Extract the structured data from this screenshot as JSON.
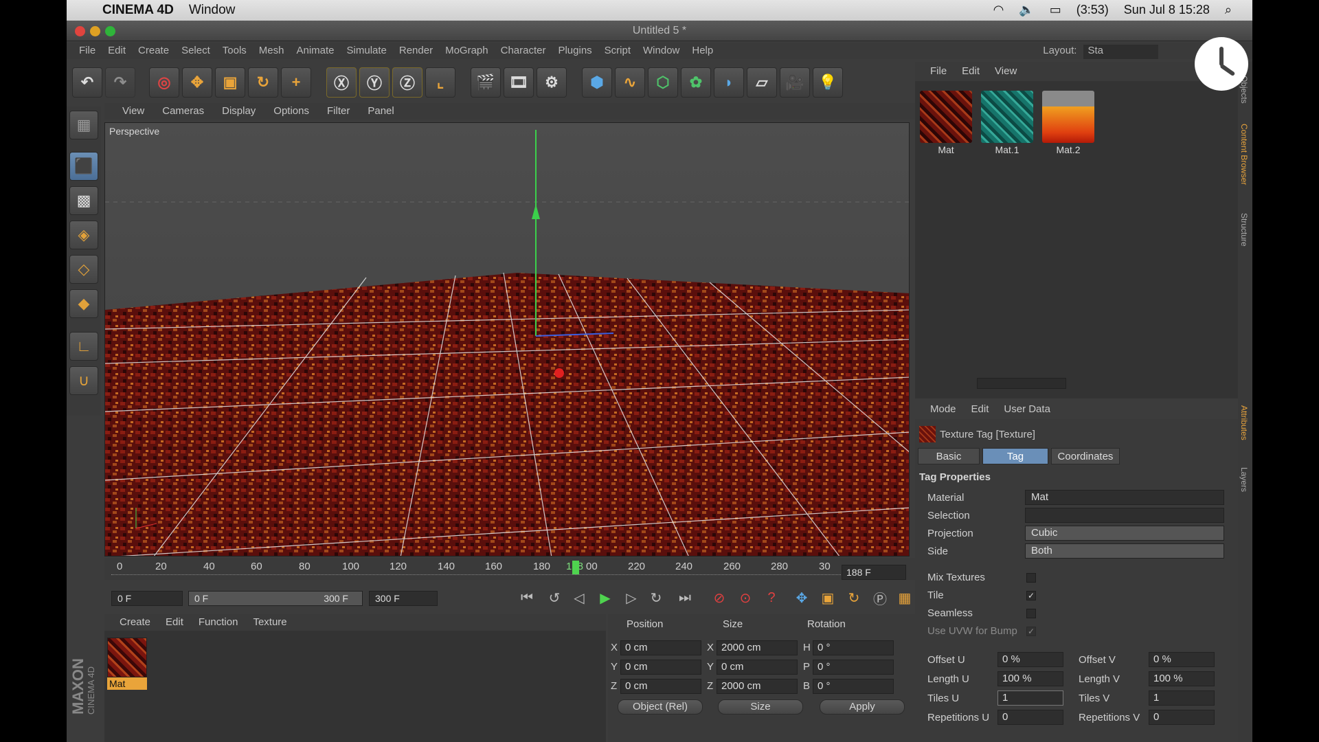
{
  "macbar": {
    "app": "CINEMA 4D",
    "window": "Window",
    "battery": "(3:53)",
    "datetime": "Sun Jul 8  15:28"
  },
  "titlebar": {
    "title": "Untitled 5 *"
  },
  "app_menu": [
    "File",
    "Edit",
    "Create",
    "Select",
    "Tools",
    "Mesh",
    "Animate",
    "Simulate",
    "Render",
    "MoGraph",
    "Character",
    "Plugins",
    "Script",
    "Window",
    "Help"
  ],
  "layout": {
    "label": "Layout:",
    "value": "Sta"
  },
  "viewport_menu": [
    "View",
    "Cameras",
    "Display",
    "Options",
    "Filter",
    "Panel"
  ],
  "viewport": {
    "label": "Perspective"
  },
  "timeline": {
    "ticks": [
      "0",
      "20",
      "40",
      "60",
      "80",
      "100",
      "120",
      "140",
      "160",
      "180",
      "188",
      "00",
      "220",
      "240",
      "260",
      "280",
      "30"
    ],
    "current_frame": "188 F",
    "playhead_fraction": 0.627
  },
  "transport": {
    "start": "0 F",
    "range_start": "0 F",
    "range_end": "300 F",
    "end": "300 F"
  },
  "material_manager": {
    "menu": [
      "Create",
      "Edit",
      "Function",
      "Texture"
    ],
    "material": "Mat",
    "brand": "MAXON",
    "brand_sub": "CINEMA 4D"
  },
  "coordinates": {
    "headers": [
      "Position",
      "Size",
      "Rotation"
    ],
    "rows": [
      {
        "axis": "X",
        "pos": "0 cm",
        "size_axis": "X",
        "size": "2000 cm",
        "rot_axis": "H",
        "rot": "0 °"
      },
      {
        "axis": "Y",
        "pos": "0 cm",
        "size_axis": "Y",
        "size": "0 cm",
        "rot_axis": "P",
        "rot": "0 °"
      },
      {
        "axis": "Z",
        "pos": "0 cm",
        "size_axis": "Z",
        "size": "2000 cm",
        "rot_axis": "B",
        "rot": "0 °"
      }
    ],
    "mode": "Object (Rel)",
    "size_mode": "Size",
    "apply": "Apply"
  },
  "content_browser": {
    "menu": [
      "File",
      "Edit",
      "View"
    ],
    "materials": [
      {
        "name": "Mat",
        "color": "#8a1a10"
      },
      {
        "name": "Mat.1",
        "color": "#1e8a7a"
      },
      {
        "name": "Mat.2",
        "color": "#e85a12"
      }
    ]
  },
  "attributes": {
    "menu": [
      "Mode",
      "Edit",
      "User Data"
    ],
    "title": "Texture Tag [Texture]",
    "tabs": [
      "Basic",
      "Tag",
      "Coordinates"
    ],
    "section": "Tag Properties",
    "material_label": "Material",
    "material_value": "Mat",
    "selection_label": "Selection",
    "selection_value": "",
    "projection_label": "Projection",
    "projection_value": "Cubic",
    "side_label": "Side",
    "side_value": "Both",
    "mix_label": "Mix Textures",
    "tile_label": "Tile",
    "seamless_label": "Seamless",
    "uvw_label": "Use UVW for Bump",
    "offset_u_label": "Offset U",
    "offset_u": "0 %",
    "offset_v_label": "Offset V",
    "offset_v": "0 %",
    "length_u_label": "Length U",
    "length_u": "100 %",
    "length_v_label": "Length V",
    "length_v": "100 %",
    "tiles_u_label": "Tiles U",
    "tiles_u": "1",
    "tiles_v_label": "Tiles V",
    "tiles_v": "1",
    "rep_u_label": "Repetitions U",
    "rep_u": "0",
    "rep_v_label": "Repetitions V",
    "rep_v": "0"
  },
  "side_tabs": [
    "Objects",
    "Content Browser",
    "Structure",
    "Attributes",
    "Layers"
  ]
}
